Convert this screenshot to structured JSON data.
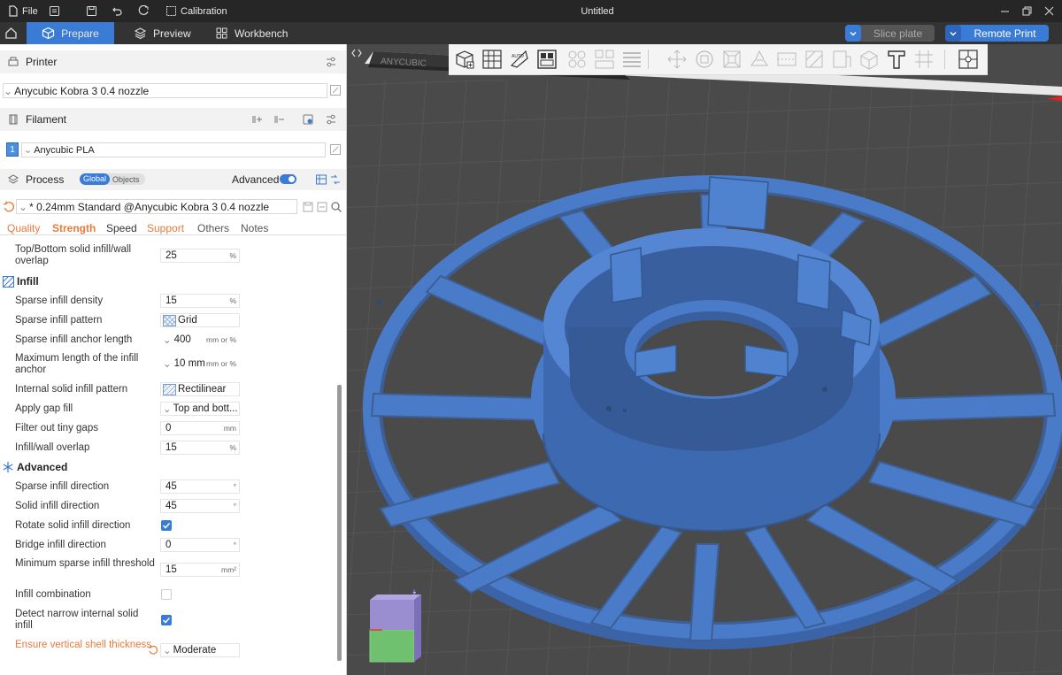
{
  "title_bar": {
    "file_label": "File",
    "calibration_label": "Calibration",
    "document_title": "Untitled"
  },
  "tabs": {
    "prepare": "Prepare",
    "preview": "Preview",
    "workbench": "Workbench",
    "slice_plate": "Slice plate",
    "remote_print": "Remote Print"
  },
  "printer": {
    "section_label": "Printer",
    "selected": "Anycubic Kobra 3 0.4 nozzle"
  },
  "filament": {
    "section_label": "Filament",
    "slot_number": "1",
    "selected": "Anycubic PLA",
    "slot_color": "#4a90e2"
  },
  "process": {
    "section_label": "Process",
    "global_label": "Global",
    "objects_label": "Objects",
    "advanced_label": "Advanced",
    "advanced_enabled": true,
    "preset": "* 0.24mm Standard @Anycubic Kobra 3 0.4 nozzle",
    "subtabs": [
      "Quality",
      "Strength",
      "Speed",
      "Support",
      "Others",
      "Notes"
    ],
    "active_subtab": "Strength"
  },
  "settings": {
    "top_bottom_overlap": {
      "label": "Top/Bottom solid infill/wall overlap",
      "value": "25",
      "unit": "%"
    },
    "infill_group": "Infill",
    "sparse_density": {
      "label": "Sparse infill density",
      "value": "15",
      "unit": "%"
    },
    "sparse_pattern": {
      "label": "Sparse infill pattern",
      "value": "Grid"
    },
    "anchor_length": {
      "label": "Sparse infill anchor length",
      "value": "400",
      "unit": "mm or %"
    },
    "max_anchor": {
      "label": "Maximum length of the infill anchor",
      "value": "10 mm",
      "unit": "mm or %"
    },
    "internal_pattern": {
      "label": "Internal solid infill pattern",
      "value": "Rectilinear"
    },
    "gap_fill": {
      "label": "Apply gap fill",
      "value": "Top and bott..."
    },
    "filter_gaps": {
      "label": "Filter out tiny gaps",
      "value": "0",
      "unit": "mm"
    },
    "wall_overlap": {
      "label": "Infill/wall overlap",
      "value": "15",
      "unit": "%"
    },
    "advanced_group": "Advanced",
    "sparse_direction": {
      "label": "Sparse infill direction",
      "value": "45",
      "unit": "°"
    },
    "solid_direction": {
      "label": "Solid infill direction",
      "value": "45",
      "unit": "°"
    },
    "rotate_solid": {
      "label": "Rotate solid infill direction",
      "checked": true
    },
    "bridge_direction": {
      "label": "Bridge infill direction",
      "value": "0",
      "unit": "°"
    },
    "min_sparse": {
      "label": "Minimum sparse infill threshold",
      "value": "15",
      "unit": "mm²"
    },
    "infill_combination": {
      "label": "Infill combination",
      "checked": false
    },
    "detect_narrow": {
      "label": "Detect narrow internal solid infill",
      "checked": true
    },
    "vertical_shell": {
      "label": "Ensure vertical shell thickness",
      "value": "Moderate"
    }
  },
  "viewport": {
    "bed_logo": "ANYCUBIC",
    "model_color": "#4a7bc8",
    "axis_label": "Z"
  },
  "colors": {
    "accent": "#3a7bd5",
    "modified_label": "#e87a3c",
    "titlebar": "#262626",
    "tabbar": "#333333"
  }
}
